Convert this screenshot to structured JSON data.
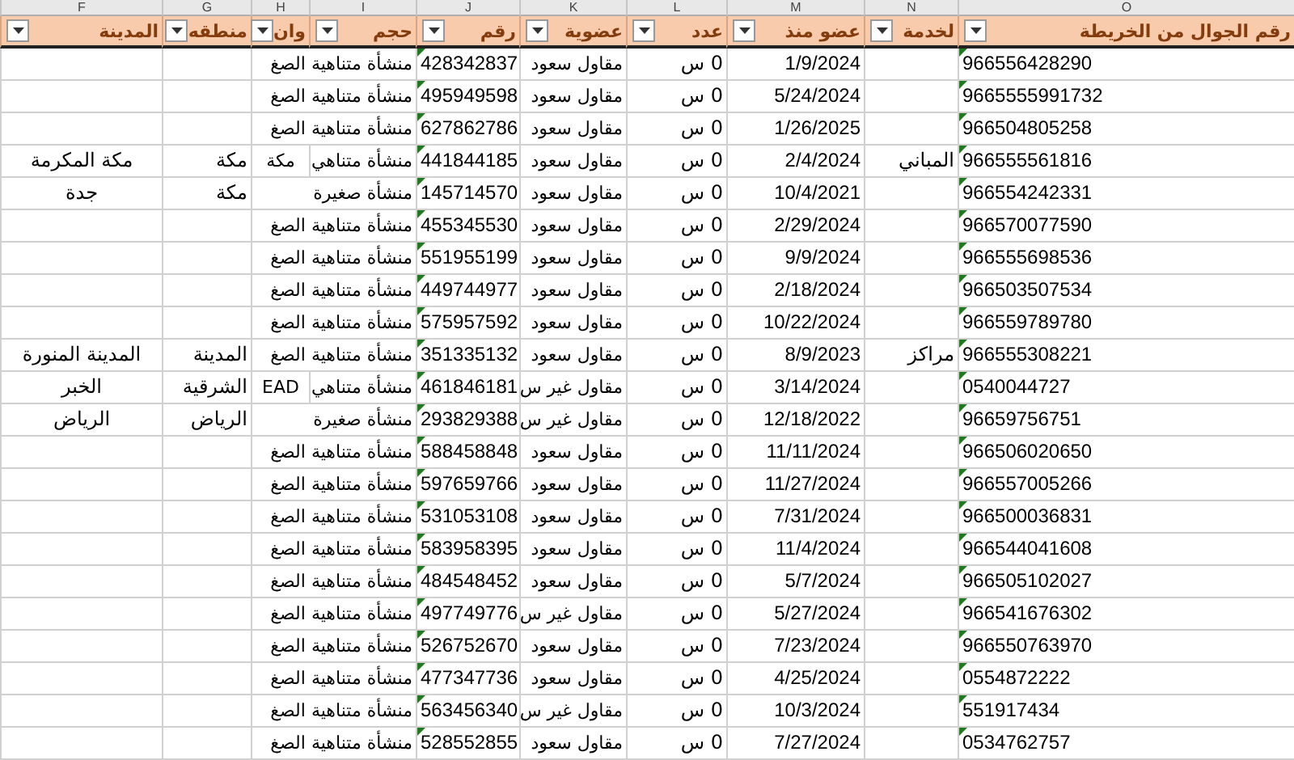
{
  "column_letters": [
    "O",
    "N",
    "M",
    "L",
    "K",
    "J",
    "I",
    "H",
    "G",
    "F"
  ],
  "headers": [
    {
      "label": "رقم الجوال من الخريطة"
    },
    {
      "label": "لخدمة"
    },
    {
      "label": "عضو منذ"
    },
    {
      "label": "عدد"
    },
    {
      "label": "عضوية"
    },
    {
      "label": "رقم"
    },
    {
      "label": "حجم"
    },
    {
      "label": "وان"
    },
    {
      "label": "منطقه"
    },
    {
      "label": "المدينة"
    }
  ],
  "rows": [
    {
      "phone": "966556428290",
      "service": "",
      "since": "1/9/2024",
      "count": "0 س",
      "membership": "مقاول سعود",
      "number": "428342837",
      "size": "منشأة متناهية الصغ",
      "address": "",
      "region": "",
      "city": ""
    },
    {
      "phone": "9665555991732",
      "service": "",
      "since": "5/24/2024",
      "count": "0 س",
      "membership": "مقاول سعود",
      "number": "495949598",
      "size": "منشأة متناهية الصغ",
      "address": "",
      "region": "",
      "city": ""
    },
    {
      "phone": "966504805258",
      "service": "",
      "since": "1/26/2025",
      "count": "0 س",
      "membership": "مقاول سعود",
      "number": "627862786",
      "size": "منشأة متناهية الصغ",
      "address": "",
      "region": "",
      "city": ""
    },
    {
      "phone": "966555561816",
      "service": "المباني",
      "since": "2/4/2024",
      "count": "0 س",
      "membership": "مقاول سعود",
      "number": "441844185",
      "size": "منشأة متناهي",
      "address": "مكة",
      "region": "مكة",
      "city": "مكة المكرمة"
    },
    {
      "phone": "966554242331",
      "service": "",
      "since": "10/4/2021",
      "count": "0 س",
      "membership": "مقاول سعود",
      "number": "145714570",
      "size": "منشأة صغيرة",
      "address": "",
      "region": "مكة",
      "city": "جدة"
    },
    {
      "phone": "966570077590",
      "service": "",
      "since": "2/29/2024",
      "count": "0 س",
      "membership": "مقاول سعود",
      "number": "455345530",
      "size": "منشأة متناهية الصغ",
      "address": "",
      "region": "",
      "city": ""
    },
    {
      "phone": "966555698536",
      "service": "",
      "since": "9/9/2024",
      "count": "0 س",
      "membership": "مقاول سعود",
      "number": "551955199",
      "size": "منشأة متناهية الصغ",
      "address": "",
      "region": "",
      "city": ""
    },
    {
      "phone": "966503507534",
      "service": "",
      "since": "2/18/2024",
      "count": "0 س",
      "membership": "مقاول سعود",
      "number": "449744977",
      "size": "منشأة متناهية الصغ",
      "address": "",
      "region": "",
      "city": ""
    },
    {
      "phone": "966559789780",
      "service": "",
      "since": "10/22/2024",
      "count": "0 س",
      "membership": "مقاول سعود",
      "number": "575957592",
      "size": "منشأة متناهية الصغ",
      "address": "",
      "region": "",
      "city": ""
    },
    {
      "phone": "966555308221",
      "service": "مراكز",
      "since": "8/9/2023",
      "count": "0 س",
      "membership": "مقاول سعود",
      "number": "351335132",
      "size": "منشأة متناهية الصغ",
      "address": "",
      "region": "المدينة",
      "city": "المدينة المنورة"
    },
    {
      "phone": "0540044727",
      "service": "",
      "since": "3/14/2024",
      "count": "0 س",
      "membership": "مقاول غير س",
      "number": "461846181",
      "size": "منشأة متناهي",
      "address": "EAD",
      "region": "الشرقية",
      "city": "الخبر"
    },
    {
      "phone": "96659756751",
      "service": "",
      "since": "12/18/2022",
      "count": "0 س",
      "membership": "مقاول غير س",
      "number": "293829388",
      "size": "منشأة صغيرة",
      "address": "",
      "region": "الرياض",
      "city": "الرياض"
    },
    {
      "phone": "966506020650",
      "service": "",
      "since": "11/11/2024",
      "count": "0 س",
      "membership": "مقاول سعود",
      "number": "588458848",
      "size": "منشأة متناهية الصغ",
      "address": "",
      "region": "",
      "city": ""
    },
    {
      "phone": "966557005266",
      "service": "",
      "since": "11/27/2024",
      "count": "0 س",
      "membership": "مقاول سعود",
      "number": "597659766",
      "size": "منشأة متناهية الصغ",
      "address": "",
      "region": "",
      "city": ""
    },
    {
      "phone": "966500036831",
      "service": "",
      "since": "7/31/2024",
      "count": "0 س",
      "membership": "مقاول سعود",
      "number": "531053108",
      "size": "منشأة متناهية الصغ",
      "address": "",
      "region": "",
      "city": ""
    },
    {
      "phone": "966544041608",
      "service": "",
      "since": "11/4/2024",
      "count": "0 س",
      "membership": "مقاول سعود",
      "number": "583958395",
      "size": "منشأة متناهية الصغ",
      "address": "",
      "region": "",
      "city": ""
    },
    {
      "phone": "966505102027",
      "service": "",
      "since": "5/7/2024",
      "count": "0 س",
      "membership": "مقاول سعود",
      "number": "484548452",
      "size": "منشأة متناهية الصغ",
      "address": "",
      "region": "",
      "city": ""
    },
    {
      "phone": "966541676302",
      "service": "",
      "since": "5/27/2024",
      "count": "0 س",
      "membership": "مقاول غير س",
      "number": "497749776",
      "size": "منشأة متناهية الصغ",
      "address": "",
      "region": "",
      "city": ""
    },
    {
      "phone": "966550763970",
      "service": "",
      "since": "7/23/2024",
      "count": "0 س",
      "membership": "مقاول سعود",
      "number": "526752670",
      "size": "منشأة متناهية الصغ",
      "address": "",
      "region": "",
      "city": ""
    },
    {
      "phone": "0554872222",
      "service": "",
      "since": "4/25/2024",
      "count": "0 س",
      "membership": "مقاول سعود",
      "number": "477347736",
      "size": "منشأة متناهية الصغ",
      "address": "",
      "region": "",
      "city": ""
    },
    {
      "phone": "551917434",
      "service": "",
      "since": "10/3/2024",
      "count": "0 س",
      "membership": "مقاول غير س",
      "number": "563456340",
      "size": "منشأة متناهية الصغ",
      "address": "",
      "region": "",
      "city": ""
    },
    {
      "phone": "0534762757",
      "service": "",
      "since": "7/27/2024",
      "count": "0 س",
      "membership": "مقاول سعود",
      "number": "528552855",
      "size": "منشأة متناهية الصغ",
      "address": "",
      "region": "",
      "city": ""
    }
  ]
}
